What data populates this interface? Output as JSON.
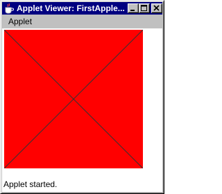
{
  "window": {
    "title": "Applet Viewer: FirstApple..."
  },
  "menubar": {
    "items": [
      {
        "label": "Applet"
      }
    ]
  },
  "applet": {
    "fill_color": "#ff0000",
    "line_color": "#333333"
  },
  "status": {
    "text": "Applet started."
  },
  "colors": {
    "titlebar": "#000080",
    "chrome": "#c0c0c0"
  }
}
